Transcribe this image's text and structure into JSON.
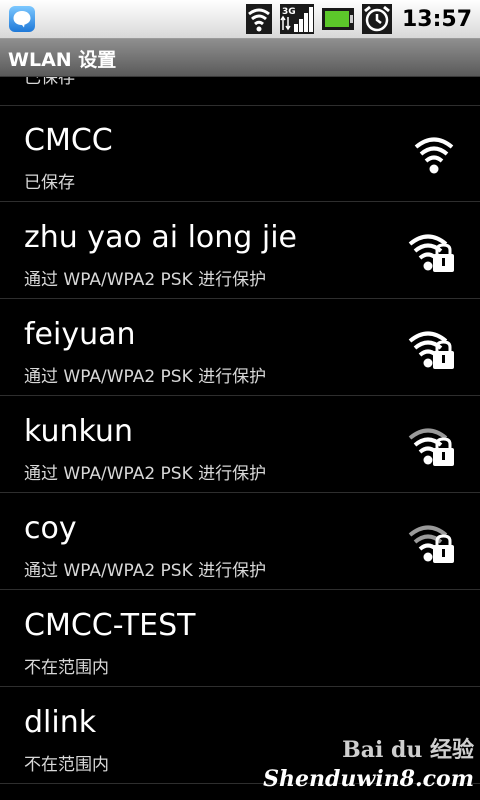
{
  "status_bar": {
    "time": "13:57",
    "icons": [
      "chat-bubble-icon",
      "wifi-status-icon",
      "3g-signal-icon",
      "battery-icon",
      "alarm-clock-icon"
    ]
  },
  "title_bar": {
    "title": "WLAN 设置"
  },
  "networks": {
    "partial": {
      "status": "已保存"
    },
    "items": [
      {
        "ssid": "CMCC",
        "status": "已保存",
        "icon": "wifi-signal-icon",
        "locked": false
      },
      {
        "ssid": "zhu yao ai long jie",
        "status": "通过 WPA/WPA2 PSK 进行保护",
        "icon": "wifi-locked-icon",
        "locked": true
      },
      {
        "ssid": "feiyuan",
        "status": "通过 WPA/WPA2 PSK 进行保护",
        "icon": "wifi-locked-icon",
        "locked": true
      },
      {
        "ssid": "kunkun",
        "status": "通过 WPA/WPA2 PSK 进行保护",
        "icon": "wifi-locked-icon",
        "locked": true
      },
      {
        "ssid": "coy",
        "status": "通过 WPA/WPA2 PSK 进行保护",
        "icon": "wifi-locked-icon",
        "locked": true
      },
      {
        "ssid": "CMCC-TEST",
        "status": "不在范围内",
        "icon": "",
        "locked": false
      },
      {
        "ssid": "dlink",
        "status": "不在范围内",
        "icon": "",
        "locked": false
      }
    ]
  },
  "watermark": {
    "brand": "Bai du 经验",
    "site": "Shenduwin8.com"
  },
  "colors": {
    "background": "#000000",
    "text": "#ffffff",
    "subtext": "#d8d8d8",
    "divider": "#2e2e2e"
  }
}
